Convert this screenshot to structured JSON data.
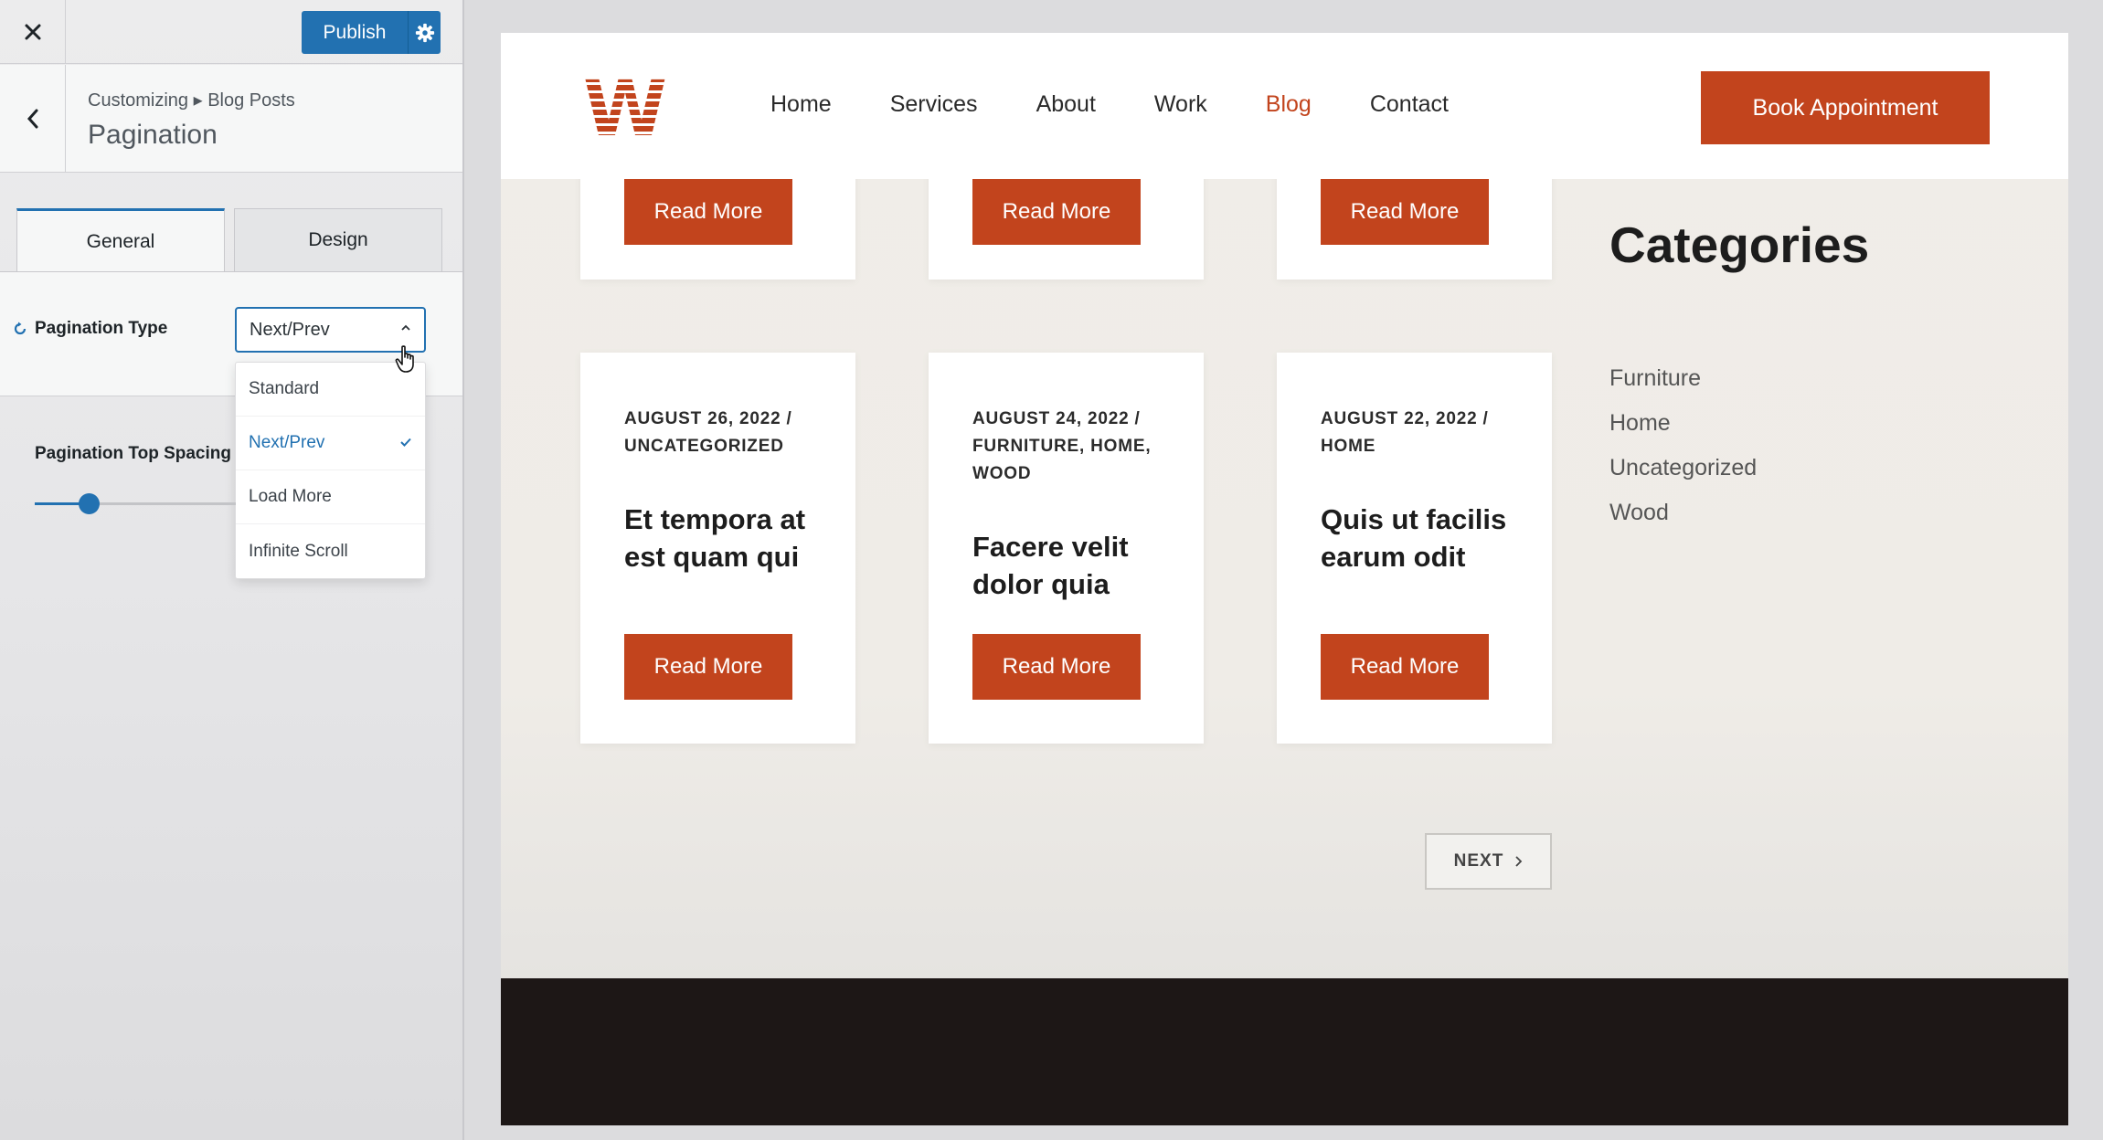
{
  "customizer": {
    "publish_label": "Publish",
    "breadcrumb": "Customizing ▸ Blog Posts",
    "section_title": "Pagination",
    "tabs": [
      {
        "label": "General",
        "active": true
      },
      {
        "label": "Design",
        "active": false
      }
    ],
    "pagination_type": {
      "label": "Pagination Type",
      "selected": "Next/Prev",
      "options": [
        "Standard",
        "Next/Prev",
        "Load More",
        "Infinite Scroll"
      ]
    },
    "top_spacing": {
      "label": "Pagination Top Spacing",
      "slider_fraction": 0.27
    }
  },
  "site": {
    "logo_letter": "W",
    "nav": [
      "Home",
      "Services",
      "About",
      "Work",
      "Blog",
      "Contact"
    ],
    "active_nav": "Blog",
    "cta_label": "Book Appointment",
    "read_more_label": "Read More",
    "posts": [
      {
        "meta": "AUGUST 26, 2022  /  UNCATEGORIZED",
        "title": "Et tempora at est quam qui"
      },
      {
        "meta": "AUGUST 24, 2022  /  FURNITURE, HOME, WOOD",
        "title": "Facere velit dolor quia"
      },
      {
        "meta": "AUGUST 22, 2022  /  HOME",
        "title": "Quis ut facilis earum odit"
      }
    ],
    "categories_title": "Categories",
    "categories": [
      "Furniture",
      "Home",
      "Uncategorized",
      "Wood"
    ],
    "next_label": "NEXT"
  },
  "colors": {
    "accent_blue": "#2271b1",
    "brand_orange": "#c2441d",
    "footer_dark": "#1d1716"
  },
  "icons": [
    "close-icon",
    "gear-icon",
    "chevron-left-icon",
    "reset-icon",
    "chevron-up-icon",
    "checkmark-icon",
    "hand-cursor-icon",
    "chevron-right-icon"
  ]
}
